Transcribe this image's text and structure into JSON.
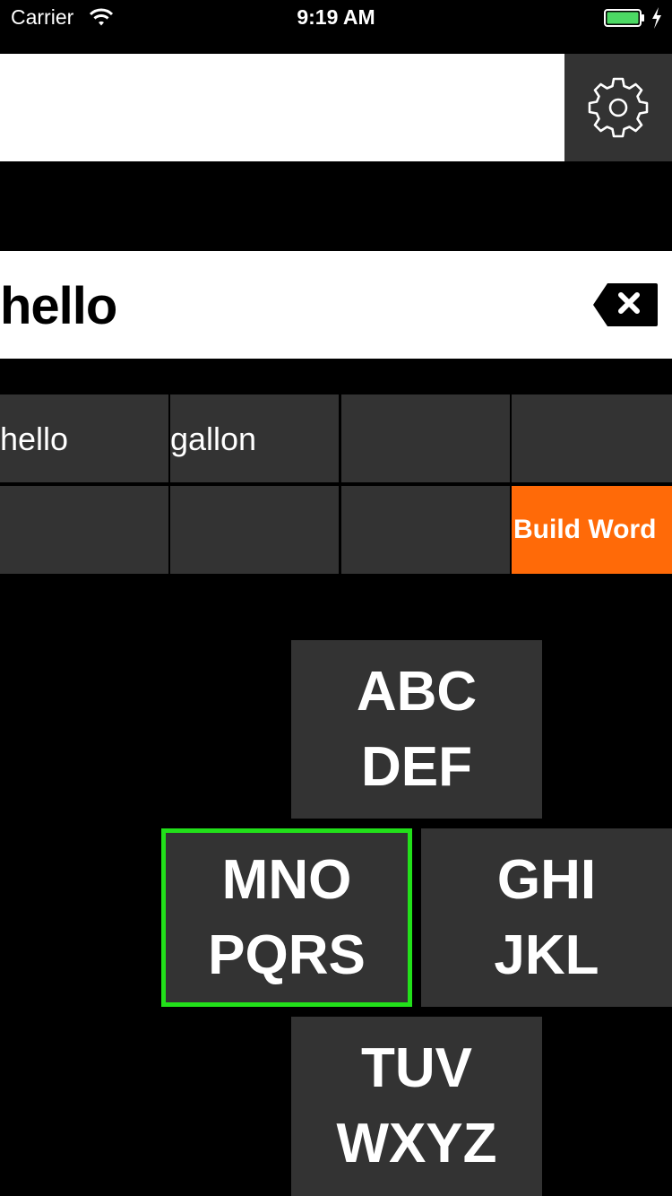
{
  "status_bar": {
    "carrier": "Carrier",
    "time": "9:19 AM",
    "wifi_icon": "wifi-icon",
    "battery_icon": "battery-charging-icon"
  },
  "top_input": {
    "value": "",
    "placeholder": ""
  },
  "settings_icon": "gear-icon",
  "word_field": {
    "value": "hello",
    "backspace_icon": "backspace-icon"
  },
  "suggestions": [
    "hello",
    "gallon",
    "",
    "",
    "",
    "",
    ""
  ],
  "build_word_label": "Build Word",
  "keys": {
    "top": {
      "line1": "ABC",
      "line2": "DEF"
    },
    "left": {
      "line1": "MNO",
      "line2": "PQRS"
    },
    "right": {
      "line1": "GHI",
      "line2": "JKL"
    },
    "bottom": {
      "line1": "TUV",
      "line2": "WXYZ"
    }
  },
  "colors": {
    "background": "#000000",
    "tile": "#333333",
    "accent": "#ff6a08",
    "selection": "#22e01a",
    "battery": "#4cd964"
  }
}
